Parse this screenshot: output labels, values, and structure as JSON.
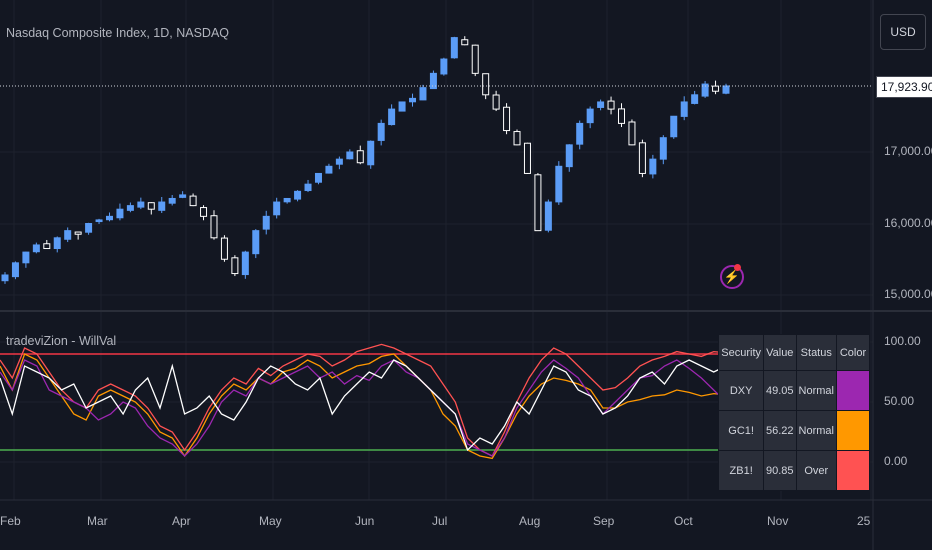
{
  "header": {
    "title": "Nasdaq Composite Index, 1D, NASDAQ",
    "currency": "USD"
  },
  "price_axis": {
    "labels": [
      "17,000.00",
      "16,000.00",
      "15,000.00"
    ],
    "last_price": "17,923.90"
  },
  "indicator": {
    "title": "tradeviZion - WillVal",
    "axis_labels": [
      "100.00",
      "50.00",
      "0.00"
    ],
    "table": {
      "headers": [
        "Security",
        "Value",
        "Status",
        "Color"
      ],
      "rows": [
        {
          "security": "DXY",
          "value": "49.05",
          "status": "Normal",
          "color": "#9c27b0"
        },
        {
          "security": "GC1!",
          "value": "56.22",
          "status": "Normal",
          "color": "#ff9800"
        },
        {
          "security": "ZB1!",
          "value": "90.85",
          "status": "Over",
          "color": "#ff5252"
        }
      ]
    }
  },
  "time_axis": {
    "labels": [
      "Feb",
      "Mar",
      "Apr",
      "May",
      "Jun",
      "Jul",
      "Aug",
      "Sep",
      "Oct",
      "Nov",
      "25"
    ]
  },
  "icons": {
    "alert": "lightning-icon"
  },
  "chart_data": [
    {
      "type": "candlestick",
      "title": "Nasdaq Composite Index, 1D, NASDAQ",
      "closes": [
        15280,
        15450,
        15600,
        15700,
        15650,
        15800,
        15900,
        15850,
        16000,
        16050,
        16100,
        16200,
        16250,
        16300,
        16200,
        16300,
        16350,
        16400,
        16250,
        16100,
        15800,
        15500,
        15300,
        15600,
        15900,
        16100,
        16300,
        16350,
        16450,
        16550,
        16700,
        16800,
        16900,
        17000,
        16850,
        17150,
        17400,
        17600,
        17700,
        17750,
        17900,
        18100,
        18300,
        18600,
        18500,
        18100,
        17800,
        17600,
        17300,
        17100,
        16700,
        15900,
        16300,
        16800,
        17100,
        17400,
        17600,
        17700,
        17600,
        17400,
        17100,
        16700,
        16900,
        17200,
        17500,
        17700,
        17800,
        17950,
        17850,
        17923.9
      ],
      "ylim": [
        14800,
        18800
      ]
    },
    {
      "type": "line",
      "title": "tradeviZion - WillVal",
      "ylim": [
        -5,
        105
      ],
      "levels": [
        90,
        10
      ],
      "series": [
        {
          "name": "NASDAQ",
          "color": "#ffffff",
          "values": [
            70,
            40,
            80,
            75,
            70,
            60,
            65,
            45,
            50,
            55,
            40,
            60,
            70,
            45,
            80,
            40,
            45,
            55,
            40,
            35,
            50,
            70,
            80,
            75,
            65,
            60,
            70,
            40,
            55,
            65,
            75,
            70,
            85,
            80,
            70,
            60,
            50,
            40,
            10,
            20,
            15,
            30,
            50,
            40,
            60,
            80,
            75,
            60,
            55,
            40,
            45,
            55,
            70,
            75,
            65,
            80,
            85,
            80,
            75,
            80
          ]
        },
        {
          "name": "DXY",
          "color": "#9c27b0",
          "values": [
            75,
            60,
            85,
            80,
            60,
            55,
            50,
            45,
            35,
            40,
            50,
            45,
            30,
            20,
            15,
            5,
            15,
            30,
            50,
            60,
            55,
            70,
            65,
            70,
            75,
            80,
            70,
            75,
            65,
            72,
            68,
            80,
            85,
            75,
            70,
            60,
            50,
            40,
            15,
            10,
            5,
            20,
            45,
            60,
            75,
            85,
            78,
            70,
            55,
            40,
            50,
            60,
            70,
            72,
            80,
            85,
            78,
            70,
            60,
            50
          ]
        },
        {
          "name": "GC1!",
          "color": "#ff9800",
          "values": [
            80,
            60,
            90,
            85,
            70,
            55,
            40,
            35,
            55,
            60,
            55,
            50,
            40,
            25,
            20,
            5,
            20,
            40,
            55,
            65,
            60,
            70,
            65,
            75,
            78,
            85,
            80,
            70,
            75,
            80,
            82,
            88,
            90,
            80,
            70,
            60,
            40,
            30,
            10,
            5,
            3,
            20,
            40,
            55,
            65,
            70,
            68,
            65,
            60,
            45,
            45,
            50,
            52,
            55,
            56,
            60,
            58,
            55,
            57,
            56
          ]
        },
        {
          "name": "ZB1!",
          "color": "#ff5252",
          "values": [
            85,
            70,
            95,
            90,
            75,
            60,
            50,
            45,
            60,
            65,
            60,
            55,
            45,
            30,
            25,
            10,
            25,
            45,
            60,
            70,
            65,
            78,
            72,
            80,
            85,
            90,
            88,
            80,
            85,
            92,
            95,
            98,
            95,
            90,
            85,
            80,
            65,
            50,
            20,
            10,
            5,
            25,
            50,
            70,
            85,
            95,
            90,
            80,
            70,
            60,
            62,
            70,
            80,
            85,
            88,
            92,
            90,
            88,
            92,
            91
          ]
        }
      ]
    }
  ]
}
